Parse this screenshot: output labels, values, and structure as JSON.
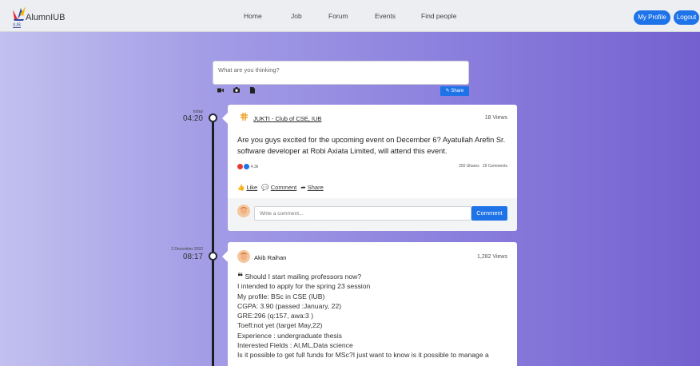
{
  "navbar": {
    "brand": "AlumnIUB",
    "brand_sub": "IUB",
    "links": [
      "Home",
      "Job",
      "Forum",
      "Events",
      "Find people"
    ],
    "my_profile": "My Profile",
    "logout": "Logout"
  },
  "composer": {
    "placeholder": "What are you thinking?",
    "share_label": "Share",
    "tools": [
      "video-icon",
      "camera-icon",
      "file-icon"
    ]
  },
  "posts": [
    {
      "date": "today",
      "time": "04:20",
      "author": "JUKTI - Club of CSE, IUB",
      "views": "18 Views",
      "text": "Are you guys excited for the upcoming event on December 6? Ayatullah Arefin Sr. software developer at Robi Axiata Limited, will attend this event.",
      "reactions_count": "4.3k",
      "shares": "250 Shares",
      "comments": "29 Comments",
      "actions": {
        "like": "Like",
        "comment": "Comment",
        "share": "Share"
      },
      "comment_placeholder": "Write a comment...",
      "comment_button": "Comment"
    },
    {
      "date": "2 December 2022",
      "time": "08:17",
      "author": "Akib Raihan",
      "views": "1,282 Views",
      "lines": [
        "Should I start mailing professors now?",
        "I intended to apply for the spring 23 session",
        "My profile: BSc in CSE (IUB)",
        "CGPA: 3.90 (passed :January, 22)",
        "GRE:296 (q:157, awa:3 )",
        "Toefl:not yet (target May,22)",
        "Experience : undergraduate thesis",
        "Interested Fields : AI,ML,Data science",
        "Is it possible to get full funds for MSc?I just want to know is it possible to manage a"
      ]
    }
  ],
  "colors": {
    "accent": "#1e73e8",
    "navbar_bg": "#eceef1",
    "reaction_love": "#e53935",
    "reaction_like": "#1e73e8"
  }
}
